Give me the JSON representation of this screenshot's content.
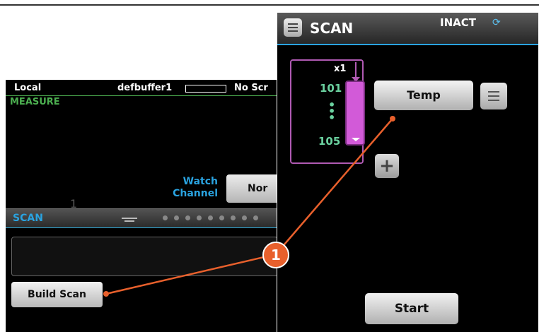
{
  "left_screen": {
    "status": {
      "local": "Local",
      "buffer": "defbuffer1",
      "script": "No Scr"
    },
    "measure_label": "MEASURE",
    "watch_channel": {
      "line1": "Watch",
      "line2": "Channel"
    },
    "none_button": "Nor",
    "faint_number": "1",
    "scan_panel": {
      "title": "SCAN"
    },
    "build_scan_button": "Build Scan"
  },
  "right_screen": {
    "title": "SCAN",
    "status": "INACT",
    "channel_group": {
      "count": "x1",
      "start": "101",
      "end": "105"
    },
    "temp_button": "Temp",
    "start_button": "Start"
  },
  "callout": {
    "number": "1"
  },
  "colors": {
    "accent_orange": "#e8602c",
    "channel_pink": "#d25ad8",
    "scan_blue": "#2aa3e0",
    "measure_green": "#4caf50"
  }
}
